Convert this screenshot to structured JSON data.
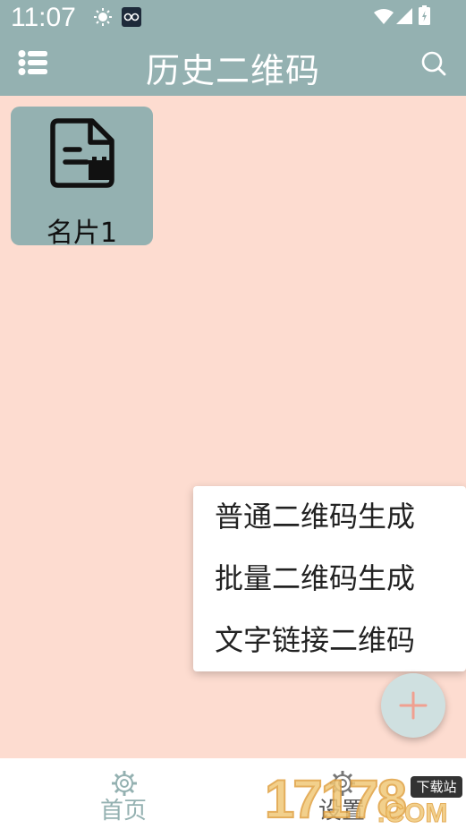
{
  "status_bar": {
    "time": "11:07",
    "icons": [
      "sun-icon",
      "glasses-icon",
      "wifi-icon",
      "signal-icon",
      "battery-icon"
    ]
  },
  "app_bar": {
    "title": "历史二维码",
    "left_icon": "list-menu-icon",
    "right_icon": "search-icon"
  },
  "history": {
    "items": [
      {
        "label": "名片1",
        "icon": "document-icon"
      }
    ]
  },
  "popup_menu": {
    "items": [
      {
        "label": "普通二维码生成"
      },
      {
        "label": "批量二维码生成"
      },
      {
        "label": "文字链接二维码"
      }
    ]
  },
  "fab": {
    "icon": "plus-icon"
  },
  "bottom_nav": {
    "items": [
      {
        "label": "首页",
        "icon": "gear-icon"
      },
      {
        "label": "设置",
        "icon": "gear-icon"
      }
    ]
  },
  "watermark": {
    "main": "17178",
    "badge": "下载站",
    "suffix": ".COM"
  },
  "colors": {
    "primary": "#94b1b1",
    "background": "#fddcd0",
    "fab": "#cfe0e0",
    "nav_label": "#94b1b1"
  }
}
